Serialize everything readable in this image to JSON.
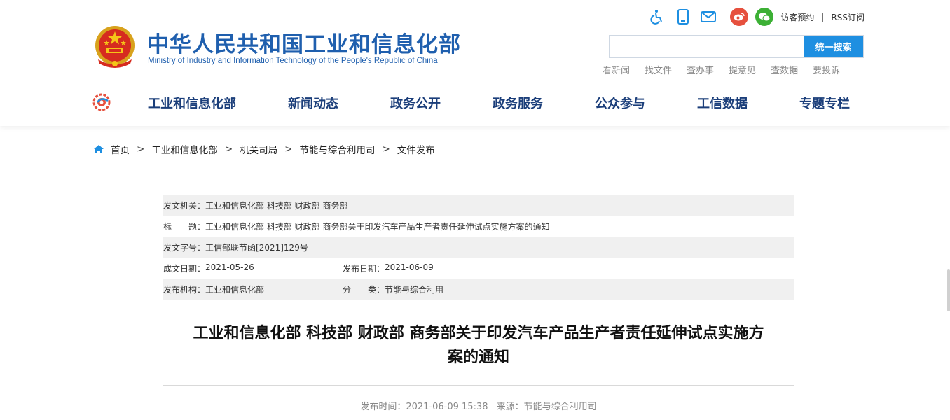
{
  "header": {
    "title": "中华人民共和国工业和信息化部",
    "subtitle": "Ministry of Industry and Information Technology of the People's Republic of China",
    "toolbar": {
      "icons": [
        "accessibility-icon",
        "mobile-icon",
        "mail-icon",
        "weibo-icon",
        "wechat-icon"
      ],
      "visitor_booking": "访客预约",
      "separator": "|",
      "rss": "RSS订阅"
    },
    "search": {
      "placeholder": "",
      "button_label": "统一搜索"
    },
    "quick_links": [
      "看新闻",
      "找文件",
      "查办事",
      "提意见",
      "查数据",
      "要投诉"
    ]
  },
  "nav": {
    "items": [
      "工业和信息化部",
      "新闻动态",
      "政务公开",
      "政务服务",
      "公众参与",
      "工信数据",
      "专题专栏"
    ]
  },
  "breadcrumb": {
    "items": [
      "首页",
      "工业和信息化部",
      "机关司局",
      "节能与综合利用司",
      "文件发布"
    ],
    "separator": ">"
  },
  "meta": {
    "issuer_label": "发文机关：",
    "issuer": "工业和信息化部 科技部 财政部 商务部",
    "title_label": "标　　题：",
    "title": "工业和信息化部 科技部 财政部 商务部关于印发汽车产品生产者责任延伸试点实施方案的通知",
    "docno_label": "发文字号：",
    "docno": "工信部联节函[2021]129号",
    "created_label": "成文日期：",
    "created": "2021-05-26",
    "published_label": "发布日期：",
    "published": "2021-06-09",
    "org_label": "发布机构：",
    "org": "工业和信息化部",
    "category_label": "分　　类：",
    "category": "节能与综合利用"
  },
  "article": {
    "title_line1": "工业和信息化部 科技部 财政部 商务部关于印发汽车产品生产者责任延伸试点实施方",
    "title_line2": "案的通知",
    "pub_time_label": "发布时间：",
    "pub_time": "2021-06-09 15:38",
    "source_label": "来源：",
    "source": "节能与综合利用司"
  },
  "colors": {
    "brand_blue": "#1f5fae",
    "nav_text": "#1b3e7a",
    "search_button": "#1e8fe1",
    "weibo_red": "#e6503e",
    "wechat_green": "#3cb035",
    "meta_shade": "#f0f0f0"
  }
}
